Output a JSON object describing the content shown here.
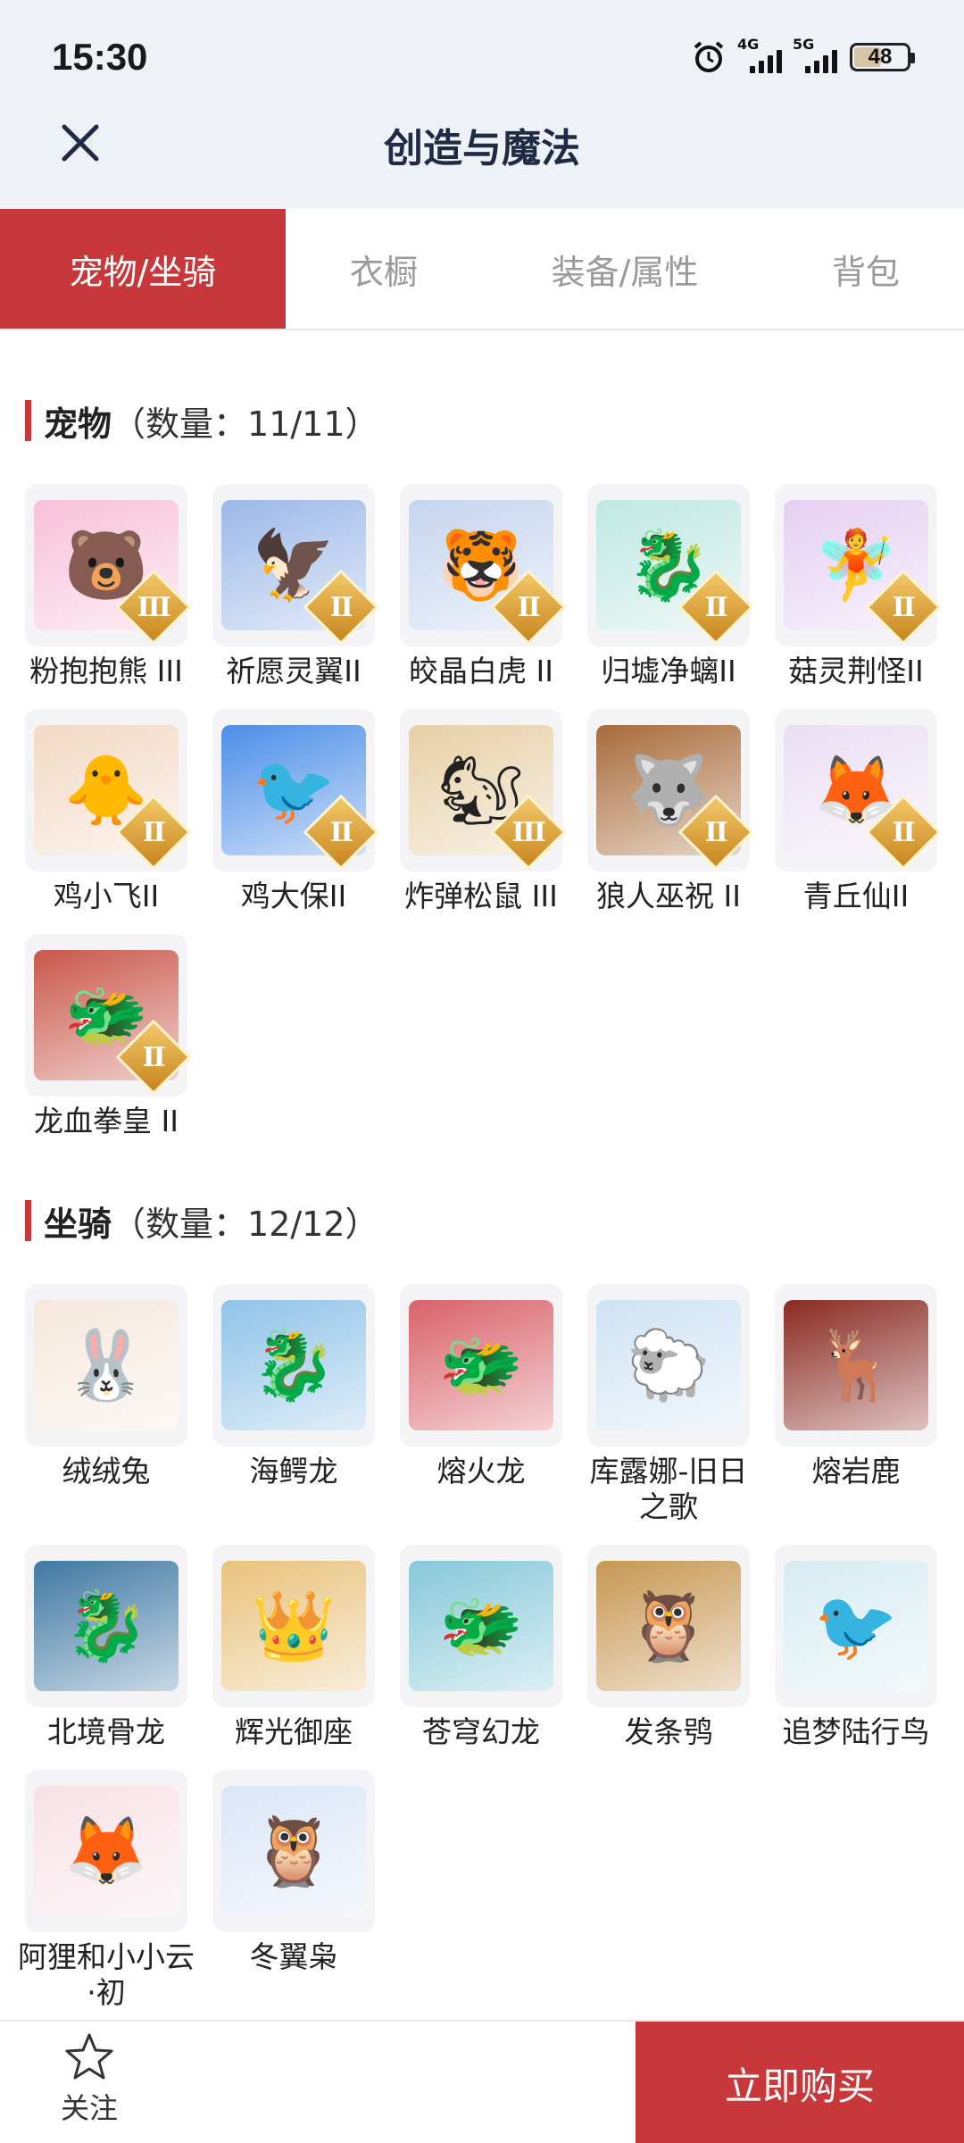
{
  "status": {
    "time": "15:30",
    "net1": "4G",
    "net2": "5G",
    "battery": "48",
    "battery_level": 0.48
  },
  "header": {
    "title": "创造与魔法"
  },
  "tabs": [
    "宠物/坐骑",
    "衣橱",
    "装备/属性",
    "背包"
  ],
  "active_tab": 0,
  "pets": {
    "name": "宠物",
    "count": "（数量：11/11）",
    "items": [
      {
        "name": "粉抱抱熊 III",
        "tier": "III",
        "icon": "pink-bear-icon",
        "bg": "#f7c1d9",
        "glyph": "🐻"
      },
      {
        "name": "祈愿灵翼II",
        "tier": "II",
        "icon": "eagle-icon",
        "bg": "#9bb8e8",
        "glyph": "🦅"
      },
      {
        "name": "皎晶白虎 II",
        "tier": "II",
        "icon": "white-tiger-icon",
        "bg": "#c5d4ee",
        "glyph": "🐯"
      },
      {
        "name": "归墟净螭II",
        "tier": "II",
        "icon": "jade-dragon-icon",
        "bg": "#bfe8e3",
        "glyph": "🐉"
      },
      {
        "name": "菇灵荆怪II",
        "tier": "II",
        "icon": "mushroom-fairy-icon",
        "bg": "#e5d0f2",
        "glyph": "🧚"
      },
      {
        "name": "鸡小飞II",
        "tier": "II",
        "icon": "chick-muscle-icon",
        "bg": "#f3d9c4",
        "glyph": "🐥"
      },
      {
        "name": "鸡大保II",
        "tier": "II",
        "icon": "blue-bird-icon",
        "bg": "#4c8ee8",
        "glyph": "🐦"
      },
      {
        "name": "炸弹松鼠 III",
        "tier": "III",
        "icon": "squirrel-icon",
        "bg": "#e7cfa6",
        "glyph": "🐿"
      },
      {
        "name": "狼人巫祝 II",
        "tier": "II",
        "icon": "werewolf-icon",
        "bg": "#a86b3a",
        "glyph": "🐺"
      },
      {
        "name": "青丘仙II",
        "tier": "II",
        "icon": "fox-fairy-icon",
        "bg": "#eadff3",
        "glyph": "🦊"
      },
      {
        "name": "龙血拳皇 II",
        "tier": "II",
        "icon": "dragon-fighter-icon",
        "bg": "#c9574a",
        "glyph": "🐲"
      }
    ]
  },
  "mounts": {
    "name": "坐骑",
    "count": "（数量：12/12）",
    "items": [
      {
        "name": "绒绒兔",
        "icon": "fluffy-rabbit-icon",
        "bg": "#f5e8dc",
        "glyph": "🐰"
      },
      {
        "name": "海鳄龙",
        "icon": "sea-dragon-icon",
        "bg": "#8fc3e8",
        "glyph": "🐉"
      },
      {
        "name": "熔火龙",
        "icon": "fire-dragon-icon",
        "bg": "#d9626a",
        "glyph": "🐲"
      },
      {
        "name": "库露娜-旧日之歌",
        "icon": "sheep-girl-icon",
        "bg": "#cfe3f3",
        "glyph": "🐑"
      },
      {
        "name": "熔岩鹿",
        "icon": "lava-deer-icon",
        "bg": "#8a2a22",
        "glyph": "🦌"
      },
      {
        "name": "北境骨龙",
        "icon": "bone-dragon-icon",
        "bg": "#3f78a3",
        "glyph": "🐉"
      },
      {
        "name": "辉光御座",
        "icon": "golden-throne-icon",
        "bg": "#e9c27c",
        "glyph": "👑"
      },
      {
        "name": "苍穹幻龙",
        "icon": "sky-dragon-icon",
        "bg": "#86c8d9",
        "glyph": "🐲"
      },
      {
        "name": "发条鸮",
        "icon": "clockwork-owl-icon",
        "bg": "#c79752",
        "glyph": "🦉"
      },
      {
        "name": "追梦陆行鸟",
        "icon": "dodo-bird-icon",
        "bg": "#d6ecf2",
        "glyph": "🐦"
      },
      {
        "name": "阿狸和小小云·初",
        "icon": "ali-fox-cloud-icon",
        "bg": "#f7e1e6",
        "glyph": "🦊"
      },
      {
        "name": "冬翼枭",
        "icon": "winter-owl-icon",
        "bg": "#dbe6f7",
        "glyph": "🦉"
      }
    ]
  },
  "bottom": {
    "follow_label": "关注",
    "buy_label": "立即购买"
  },
  "colors": {
    "accent": "#c8383a",
    "header_bg": "#eef2f7",
    "tier_gold": "#d99b2e"
  }
}
